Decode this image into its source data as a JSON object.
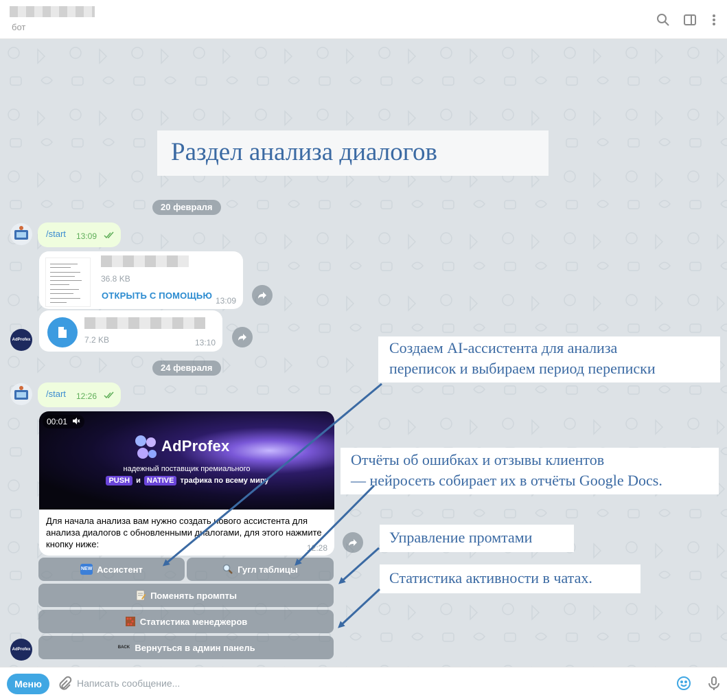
{
  "header": {
    "subtitle": "бот",
    "icons": [
      "search-icon",
      "sidebar-toggle-icon",
      "more-vertical-icon"
    ]
  },
  "banner": {
    "text": "Раздел анализа диалогов"
  },
  "dates": {
    "first": "20 февраля",
    "second": "24 февраля"
  },
  "messages": {
    "start1": {
      "text": "/start",
      "time": "13:09"
    },
    "doc1": {
      "size": "36.8 KB",
      "action": "ОТКРЫТЬ С ПОМОЩЬЮ",
      "time": "13:09"
    },
    "doc2": {
      "size": "7.2 KB",
      "time": "13:10"
    },
    "start2": {
      "text": "/start",
      "time": "12:26"
    },
    "video": {
      "duration": "00:01",
      "brand": "AdProfex",
      "tagline1": "надежный поставщик премиального",
      "tag_push": "PUSH",
      "tag_and": "и",
      "tag_native": "NATIVE",
      "tag_tail": "трафика по всему миру",
      "text": "Для начала анализа вам нужно создать нового ассистента для анализа диалогов с обновленными диалогами, для этого нажмите кнопку ниже:",
      "time": "12:28"
    }
  },
  "avatar_bot_label": "AdProfex",
  "keyboard": {
    "assistant": "Ассистент",
    "assistant_badge": "NEW",
    "sheets": "Гугл таблицы",
    "prompts": "Поменять промпты",
    "stats": "Статистика менеджеров",
    "back": "Вернуться в админ панель",
    "back_badge": "BACK"
  },
  "annotations": {
    "a1_line1": "Создаем AI-ассистента для анализа",
    "a1_line2": "переписок и выбираем период переписки",
    "a2_line1": "Отчёты об ошибках и отзывы клиентов",
    "a2_line2": " — нейросеть собирает их в отчёты Google Docs.",
    "a3": "Управление промтами",
    "a4": "Статистика активности в чатах."
  },
  "footer": {
    "menu_label": "Меню",
    "input_placeholder": "Написать сообщение..."
  },
  "colors": {
    "chat_bg": "#dde2e6",
    "outgoing_bubble": "#effdde",
    "accent": "#40a7e3",
    "annotation_text": "#3b6aa3",
    "arrow": "#3b6aa3"
  }
}
